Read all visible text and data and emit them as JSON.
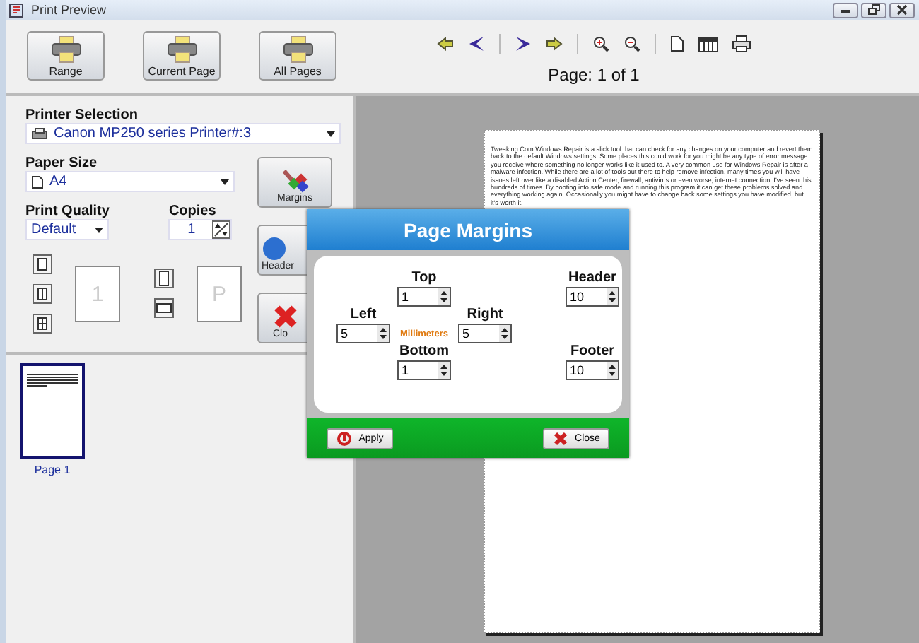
{
  "window": {
    "title": "Print Preview"
  },
  "toolbar": {
    "buttons": [
      {
        "label": "Range"
      },
      {
        "label": "Current Page"
      },
      {
        "label": "All Pages"
      }
    ],
    "page_indicator": "Page: 1 of 1"
  },
  "settings": {
    "printer_label": "Printer Selection",
    "printer": "Canon MP250 series Printer#:3",
    "paper_label": "Paper Size",
    "paper": "A4",
    "quality_label": "Print Quality",
    "quality": "Default",
    "copies_label": "Copies",
    "copies": "1",
    "order_preview": "1",
    "orientation_preview": "P"
  },
  "side_buttons": [
    {
      "label": "Margins"
    },
    {
      "label": "Header"
    },
    {
      "label": "Clo"
    }
  ],
  "thumbnails": [
    {
      "label": "Page 1",
      "selected": true
    }
  ],
  "preview_text": "Tweaking.Com Windows Repair is a slick tool that can check for any changes on your computer and revert them back to the default Windows settings. Some places this could work for you might be any type of error message you receive where something no longer works like it used to. A very common use for Windows Repair is after a malware infection. While there are a lot of tools out there to help remove infection, many times you will have issues left over like a disabled Action Center, firewall, antivirus or even worse, internet connection. I've seen this hundreds of times. By booting into safe mode and running this program it can get these problems solved and everything working again. Occasionally you might have to change back some settings you have modified, but it's worth it.",
  "dialog": {
    "title": "Page Margins",
    "unit": "Millimeters",
    "fields": [
      {
        "label": "Top",
        "value": "1"
      },
      {
        "label": "Header",
        "value": "10"
      },
      {
        "label": "Left",
        "value": "5"
      },
      {
        "label": "Right",
        "value": "5"
      },
      {
        "label": "Bottom",
        "value": "1"
      },
      {
        "label": "Footer",
        "value": "10"
      }
    ],
    "buttons": [
      {
        "label": "Apply"
      },
      {
        "label": "Close"
      }
    ]
  }
}
